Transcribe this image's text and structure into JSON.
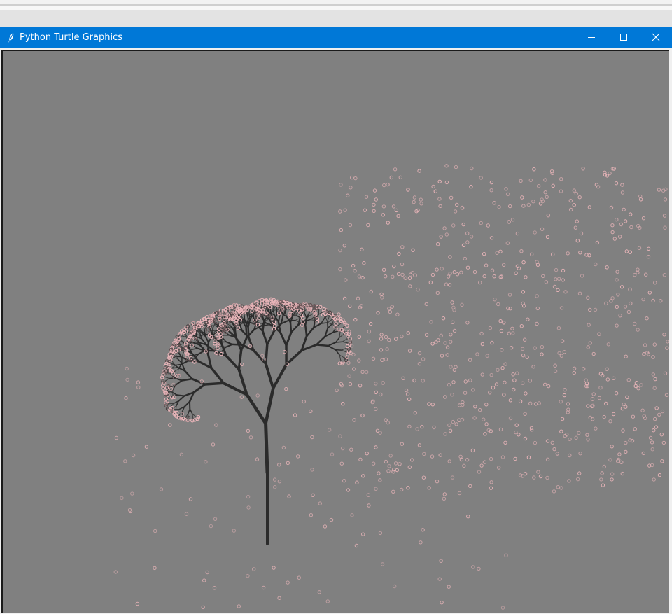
{
  "window": {
    "title": "Python Turtle Graphics",
    "icon": "feather-icon",
    "controls": [
      "minimize-icon",
      "maximize-icon",
      "close-icon"
    ]
  },
  "canvas": {
    "background": "#808080",
    "trunk_color": "#2b2b2b",
    "petal_color": "#e8b4b8",
    "petal_shadow": "#4a3f40"
  }
}
